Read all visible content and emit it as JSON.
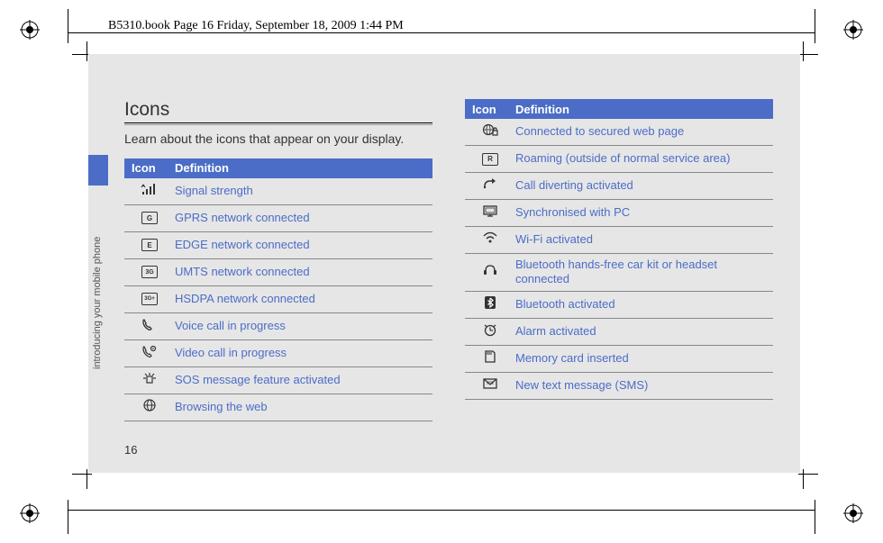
{
  "header": {
    "running_head": "B5310.book  Page 16  Friday, September 18, 2009  1:44 PM"
  },
  "page": {
    "side_label": "introducing your mobile phone",
    "number": "16"
  },
  "section": {
    "title": "Icons",
    "intro": "Learn about the icons that appear on your display."
  },
  "table_headers": {
    "icon": "Icon",
    "definition": "Definition"
  },
  "left_items": [
    {
      "icon": "signal-strength-icon",
      "def": "Signal strength"
    },
    {
      "icon": "gprs-icon",
      "def": "GPRS network connected"
    },
    {
      "icon": "edge-icon",
      "def": "EDGE network connected"
    },
    {
      "icon": "umts-icon",
      "def": "UMTS network connected"
    },
    {
      "icon": "hsdpa-icon",
      "def": "HSDPA network connected"
    },
    {
      "icon": "voice-call-icon",
      "def": "Voice call in progress"
    },
    {
      "icon": "video-call-icon",
      "def": "Video call in progress"
    },
    {
      "icon": "sos-icon",
      "def": "SOS message feature activated"
    },
    {
      "icon": "browsing-icon",
      "def": "Browsing the web"
    }
  ],
  "right_items": [
    {
      "icon": "secure-web-icon",
      "def": "Connected to secured web page"
    },
    {
      "icon": "roaming-icon",
      "def": "Roaming (outside of normal service area)"
    },
    {
      "icon": "call-divert-icon",
      "def": "Call diverting activated"
    },
    {
      "icon": "sync-pc-icon",
      "def": "Synchronised with PC"
    },
    {
      "icon": "wifi-icon",
      "def": "Wi-Fi activated"
    },
    {
      "icon": "bt-headset-icon",
      "def": "Bluetooth hands-free car kit or headset connected"
    },
    {
      "icon": "bluetooth-icon",
      "def": "Bluetooth activated"
    },
    {
      "icon": "alarm-icon",
      "def": "Alarm activated"
    },
    {
      "icon": "memory-card-icon",
      "def": "Memory card inserted"
    },
    {
      "icon": "sms-icon",
      "def": "New text message (SMS)"
    }
  ]
}
